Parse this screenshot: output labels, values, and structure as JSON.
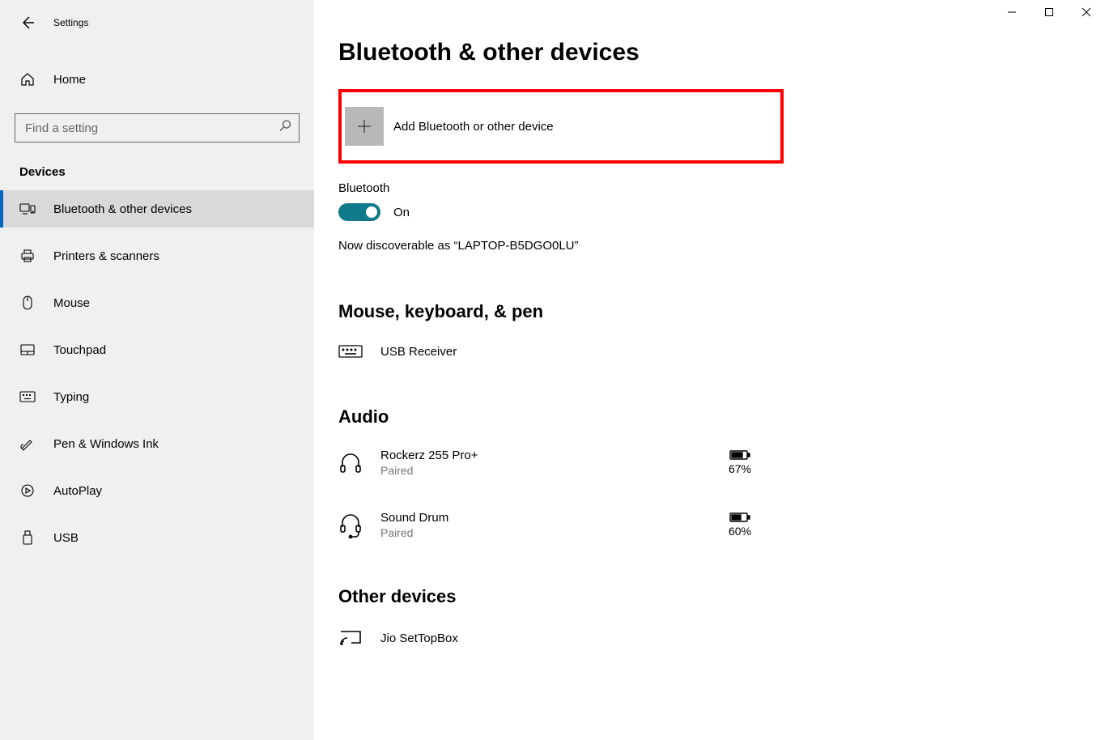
{
  "app": {
    "title": "Settings"
  },
  "sidebar": {
    "home": "Home",
    "search_placeholder": "Find a setting",
    "section": "Devices",
    "items": [
      {
        "label": "Bluetooth & other devices",
        "active": true
      },
      {
        "label": "Printers & scanners"
      },
      {
        "label": "Mouse"
      },
      {
        "label": "Touchpad"
      },
      {
        "label": "Typing"
      },
      {
        "label": "Pen & Windows Ink"
      },
      {
        "label": "AutoPlay"
      },
      {
        "label": "USB"
      }
    ]
  },
  "main": {
    "heading": "Bluetooth & other devices",
    "add_device": "Add Bluetooth or other device",
    "bluetooth_label": "Bluetooth",
    "bluetooth_state": "On",
    "discoverable": "Now discoverable as “LAPTOP-B5DGO0LU”",
    "section_mouse": "Mouse, keyboard, & pen",
    "mouse_devices": [
      {
        "name": "USB Receiver"
      }
    ],
    "section_audio": "Audio",
    "audio_devices": [
      {
        "name": "Rockerz 255 Pro+",
        "status": "Paired",
        "battery": "67%"
      },
      {
        "name": "Sound Drum",
        "status": "Paired",
        "battery": "60%"
      }
    ],
    "section_other": "Other devices",
    "other_devices": [
      {
        "name": "Jio SetTopBox"
      }
    ]
  }
}
